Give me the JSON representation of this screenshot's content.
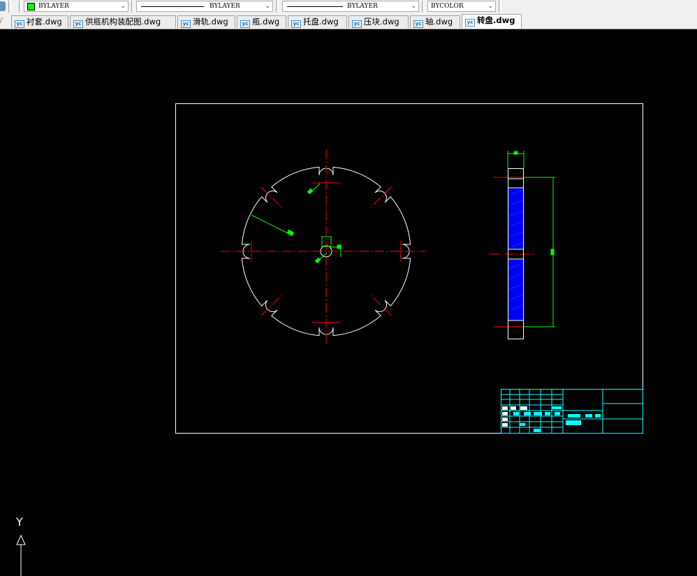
{
  "toolbar": {
    "color_combo": {
      "value": "BYLAYER",
      "swatch_color": "#00ff00"
    },
    "linetype_combo": {
      "value": "BYLAYER"
    },
    "lineweight_combo": {
      "value": "BYLAYER"
    },
    "plotstyle_combo": {
      "value": "BYCOLOR"
    }
  },
  "tabs": [
    {
      "label": "衬套.dwg",
      "active": false
    },
    {
      "label": "供瓶机构装配图.dwg",
      "active": false
    },
    {
      "label": "滑轨.dwg",
      "active": false
    },
    {
      "label": "瓶.dwg",
      "active": false
    },
    {
      "label": "托盘.dwg",
      "active": false
    },
    {
      "label": "压块.dwg",
      "active": false
    },
    {
      "label": "轴.dwg",
      "active": false
    },
    {
      "label": "转盘.dwg",
      "active": true
    }
  ],
  "tab_icon_text": "yc",
  "ucs": {
    "axis_label": "Y"
  },
  "colors": {
    "background": "#000000",
    "geometry": "#ffffff",
    "centerline": "#ff0000",
    "dimension": "#00ff00",
    "hatch": "#0000ff",
    "title_block": "#00ffff"
  }
}
